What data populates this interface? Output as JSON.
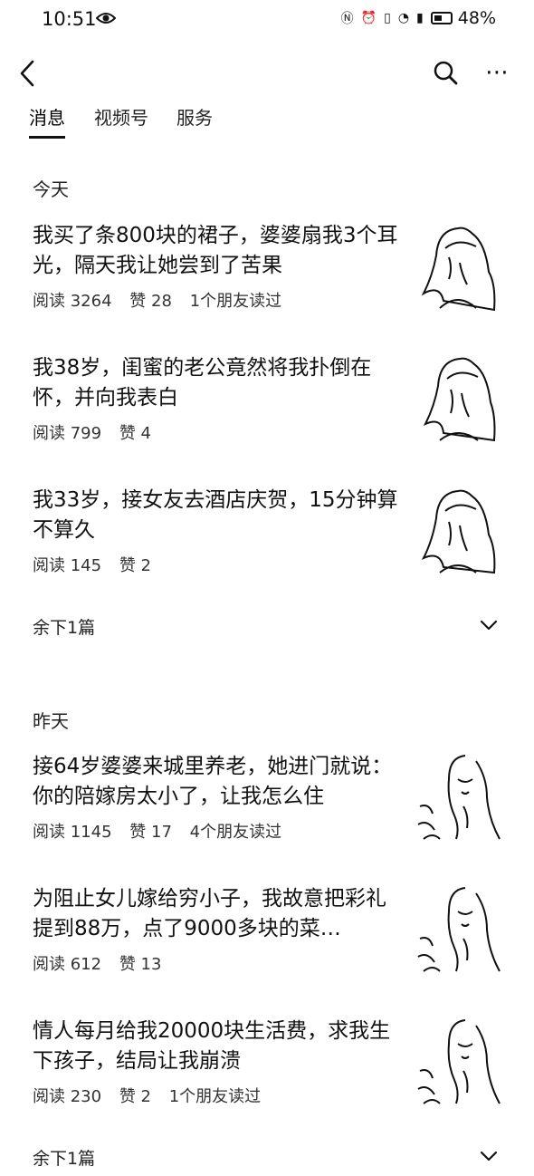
{
  "status_bar": {
    "time": "10:51",
    "battery_percent": "48%",
    "icons": [
      "eye-icon",
      "nfc-icon",
      "alarm-icon",
      "vibrate-icon",
      "wifi-icon",
      "signal-icon",
      "battery-icon"
    ]
  },
  "nav": {
    "title": "",
    "back_icon": "chevron-left-icon",
    "search_icon": "search-icon",
    "more_icon": "more-horizontal-icon"
  },
  "tabs": [
    {
      "label": "消息"
    },
    {
      "label": "视频号"
    },
    {
      "label": "服务"
    }
  ],
  "sections": [
    {
      "label": "今天",
      "articles": [
        {
          "title": "我买了条800块的裙子，婆婆扇我3个耳光，隔天我让她尝到了苦果",
          "reads": "阅读 3264",
          "likes": "赞 28",
          "friends": "1个朋友读过"
        },
        {
          "title": "我38岁，闺蜜的老公竟然将我扑倒在怀，并向我表白",
          "reads": "阅读 799",
          "likes": "赞 4",
          "friends": ""
        },
        {
          "title": "我33岁，接女友去酒店庆贺，15分钟算不算久",
          "reads": "阅读 145",
          "likes": "赞 2",
          "friends": ""
        }
      ],
      "more": "余下1篇"
    },
    {
      "label": "昨天",
      "articles": [
        {
          "title": "接64岁婆婆来城里养老，她进门就说：你的陪嫁房太小了，让我怎么住",
          "reads": "阅读 1145",
          "likes": "赞 17",
          "friends": "4个朋友读过"
        },
        {
          "title": "为阻止女儿嫁给穷小子，我故意把彩礼提到88万，点了9000多块的菜…",
          "reads": "阅读 612",
          "likes": "赞 13",
          "friends": ""
        },
        {
          "title": "情人每月给我20000块生活费，求我生下孩子，结局让我崩溃",
          "reads": "阅读 230",
          "likes": "赞 2",
          "friends": "1个朋友读过"
        }
      ],
      "more": "余下1篇"
    }
  ]
}
